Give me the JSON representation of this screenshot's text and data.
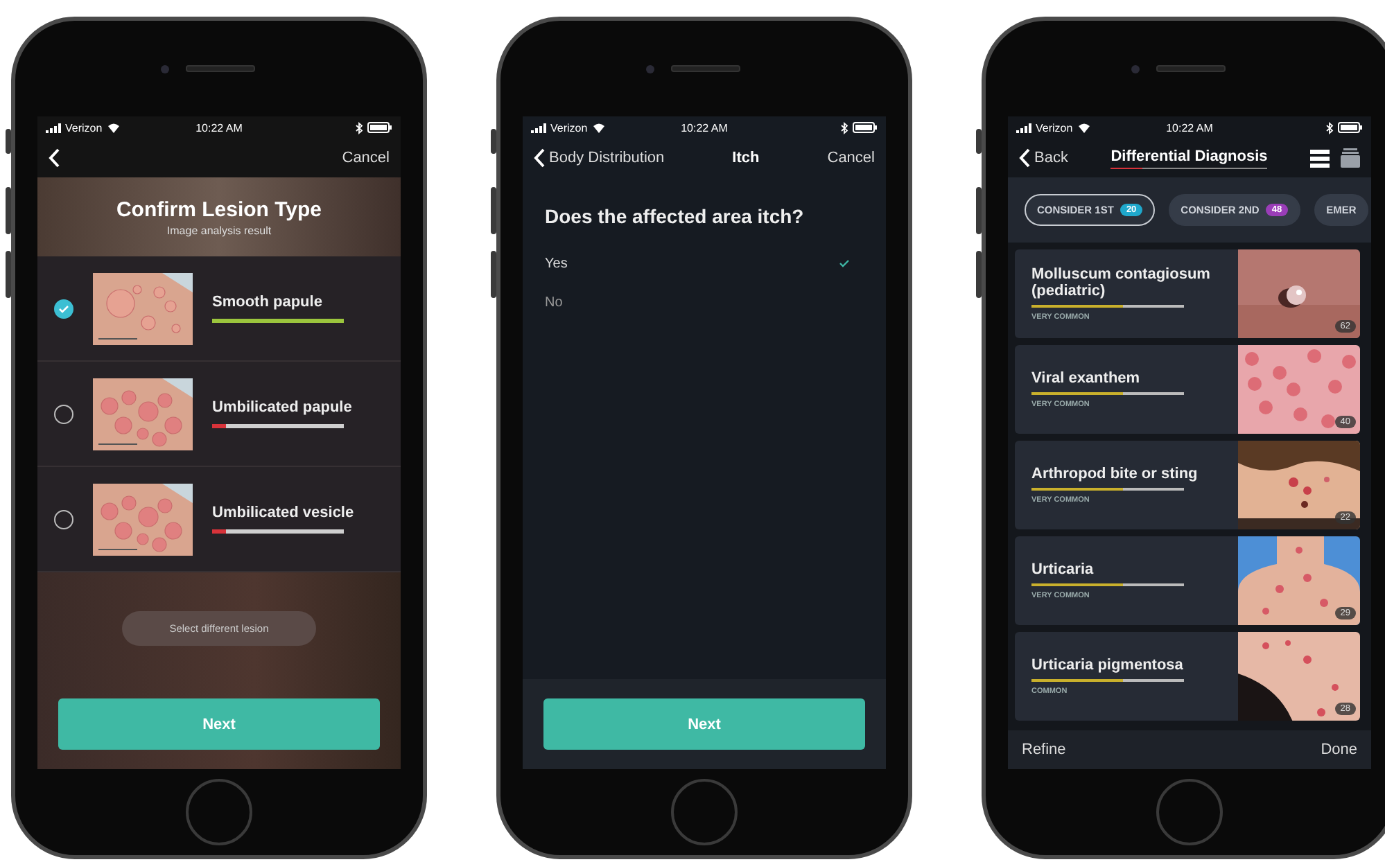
{
  "phones": [
    {
      "kind": "confirm",
      "status_bar": {
        "carrier": "Verizon",
        "time": "10:22 AM"
      },
      "nav": {
        "right": "Cancel"
      },
      "title": "Confirm Lesion Type",
      "subtitle": "Image analysis result",
      "options": [
        {
          "name": "Smooth papule",
          "selected": true,
          "level": 1,
          "color": "#9bc53d"
        },
        {
          "name": "Umbilicated papule",
          "selected": false,
          "level": 0.1,
          "color": "#d8333a"
        },
        {
          "name": "Umbilicated vesicle",
          "selected": false,
          "level": 0.1,
          "color": "#d8333a"
        }
      ],
      "secondary_button": "Select different lesion",
      "primary_button": "Next"
    },
    {
      "kind": "question",
      "status_bar": {
        "carrier": "Verizon",
        "time": "10:22 AM"
      },
      "nav": {
        "back": "Body Distribution",
        "title": "Itch",
        "right": "Cancel"
      },
      "question": "Does the affected area itch?",
      "answers": [
        {
          "label": "Yes",
          "selected": true
        },
        {
          "label": "No",
          "selected": false
        }
      ],
      "primary_button": "Next"
    },
    {
      "kind": "diagnosis",
      "status_bar": {
        "carrier": "Verizon",
        "time": "10:22 AM"
      },
      "nav": {
        "back": "Back",
        "title": "Differential Diagnosis",
        "level": 0.2
      },
      "tabs": [
        {
          "label": "CONSIDER 1ST",
          "count": "20",
          "color": "#1fa8cc",
          "selected": true
        },
        {
          "label": "CONSIDER 2ND",
          "count": "48",
          "color": "#9a3db8",
          "selected": false
        },
        {
          "label": "EMER",
          "selected": false
        }
      ],
      "results": [
        {
          "name": "Molluscum contagiosum (pediatric)",
          "level": 0.6,
          "frequency": "VERY COMMON",
          "count": "62"
        },
        {
          "name": "Viral exanthem",
          "level": 0.6,
          "frequency": "VERY COMMON",
          "count": "40"
        },
        {
          "name": "Arthropod bite or sting",
          "level": 0.6,
          "frequency": "VERY COMMON",
          "count": "22"
        },
        {
          "name": "Urticaria",
          "level": 0.6,
          "frequency": "VERY COMMON",
          "count": "29"
        },
        {
          "name": "Urticaria pigmentosa",
          "level": 0.6,
          "frequency": "COMMON",
          "count": "28"
        }
      ],
      "toolbar": {
        "left": "Refine",
        "right": "Done"
      }
    }
  ]
}
